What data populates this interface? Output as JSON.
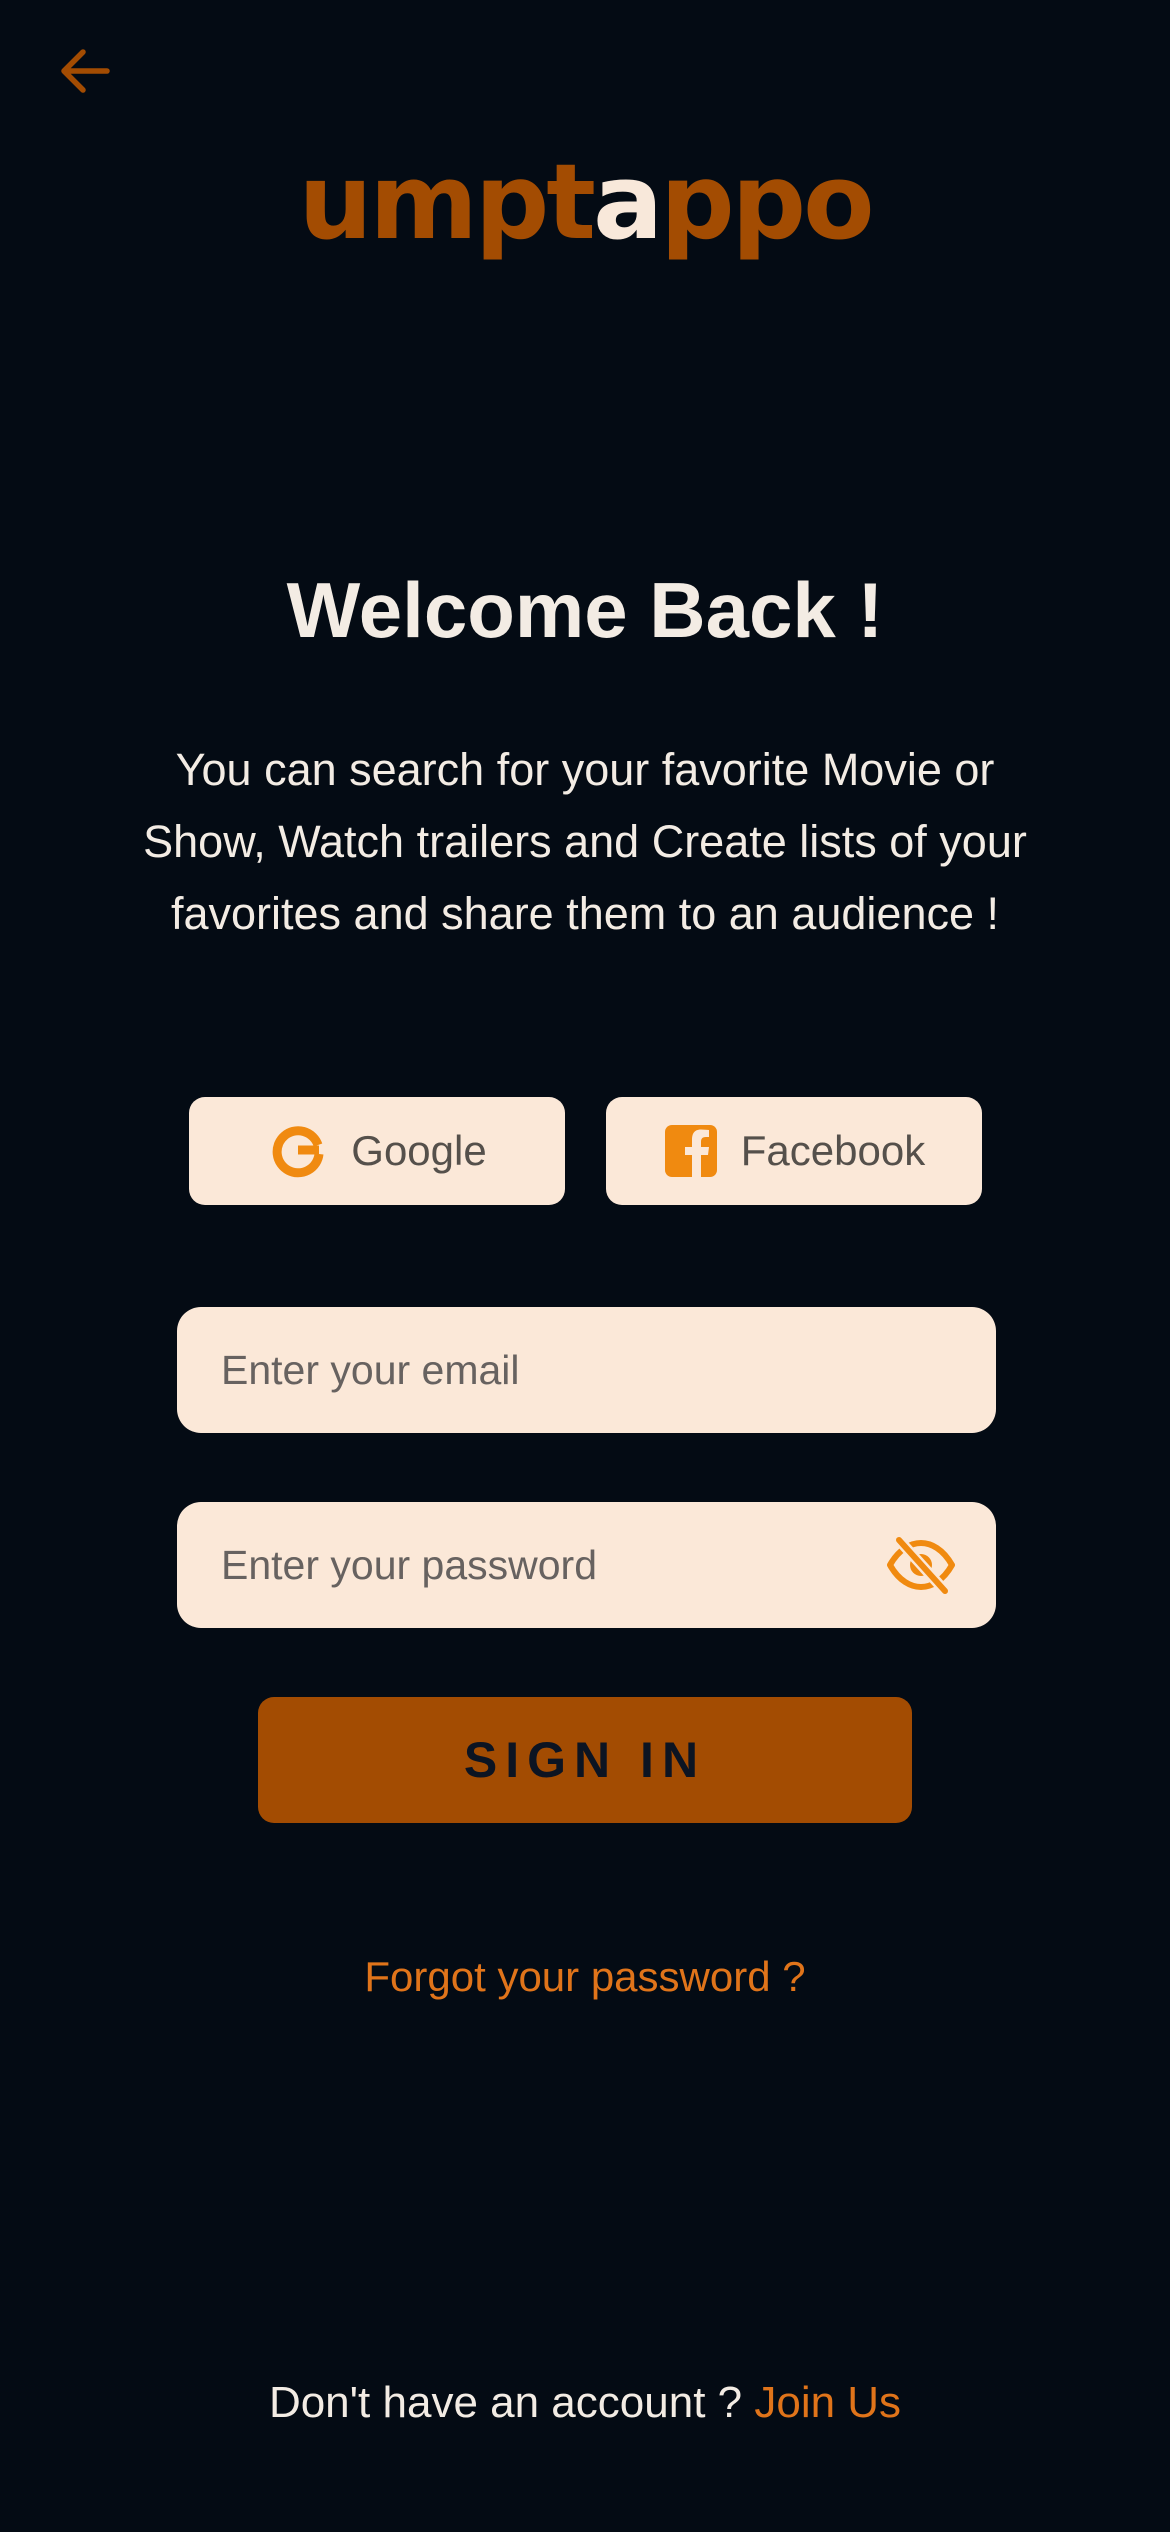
{
  "header": {
    "back_icon": "arrow-left-icon",
    "logo_part1": "umpt",
    "logo_part2": "a",
    "logo_part3": "ppo"
  },
  "welcome": {
    "title": "Welcome Back !",
    "subtitle": "You can search for your favorite Movie or Show, Watch trailers and Create lists of your favorites and share them to an audience !"
  },
  "social": {
    "google_label": "Google",
    "google_icon": "google-icon",
    "facebook_label": "Facebook",
    "facebook_icon": "facebook-icon"
  },
  "form": {
    "email_placeholder": "Enter your email",
    "email_value": "",
    "password_placeholder": "Enter your password",
    "password_value": "",
    "password_toggle_icon": "eye-off-icon",
    "signin_label": "SIGN IN",
    "forgot_label": "Forgot your password ?"
  },
  "footer": {
    "prompt": "Don't have an account ?",
    "join_label": "Join Us"
  },
  "colors": {
    "background": "#040b14",
    "accent": "#a34c02",
    "accent_bright": "#e0741a",
    "field_background": "#fbe8d8",
    "icon_orange": "#f08a10"
  }
}
